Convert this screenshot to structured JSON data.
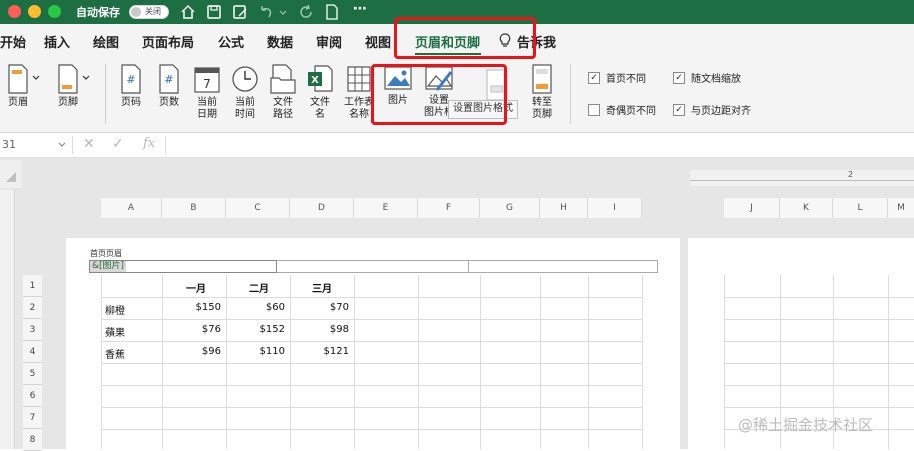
{
  "titlebar": {
    "autosave_label": "自动保存",
    "autosave_state": "关闭",
    "more_icon": "more-icon"
  },
  "tabs": [
    "开始",
    "插入",
    "绘图",
    "页面布局",
    "公式",
    "数据",
    "审阅",
    "视图",
    "页眉和页脚",
    "告诉我"
  ],
  "active_tab": "页眉和页脚",
  "ribbon": {
    "header": "页眉",
    "footer": "页脚",
    "page_number": "页码",
    "page_count": "页数",
    "current_date_1": "当前",
    "current_date_2": "日期",
    "current_time_1": "当前",
    "current_time_2": "时间",
    "file_path_1": "文件",
    "file_path_2": "路径",
    "file_name_1": "文件",
    "file_name_2": "名",
    "sheet_name_1": "工作表",
    "sheet_name_2": "名称",
    "picture": "图片",
    "format_picture_1": "设置",
    "format_picture_2": "图片格",
    "goto_footer_1": "转至",
    "goto_footer_2": "页脚",
    "first_page_diff": "首页不同",
    "odd_even_diff": "奇偶页不同",
    "scale_with_doc": "随文档缩放",
    "align_margins": "与页边距对齐"
  },
  "tooltip": "设置图片格式",
  "formula_bar": {
    "cell_ref": "31",
    "fx": "fx"
  },
  "columns_left": [
    "A",
    "B",
    "C",
    "D",
    "E",
    "F",
    "G",
    "H",
    "I"
  ],
  "columns_right": [
    "J",
    "K",
    "L",
    "M"
  ],
  "header_label": "首页页眉",
  "header_field": "&[图片]",
  "table": {
    "months": [
      "一月",
      "二月",
      "三月"
    ],
    "rows": [
      {
        "name": "柳橙",
        "v1": "$150",
        "v2": "$60",
        "v3": "$70"
      },
      {
        "name": "蘋果",
        "v1": "$76",
        "v2": "$152",
        "v3": "$98"
      },
      {
        "name": "香蕉",
        "v1": "$96",
        "v2": "$110",
        "v3": "$121"
      }
    ]
  },
  "row_numbers": [
    "1",
    "2",
    "3",
    "4",
    "5",
    "6",
    "7",
    "8"
  ],
  "ruler_mark": "2",
  "watermark": "@稀土掘金技术社区"
}
